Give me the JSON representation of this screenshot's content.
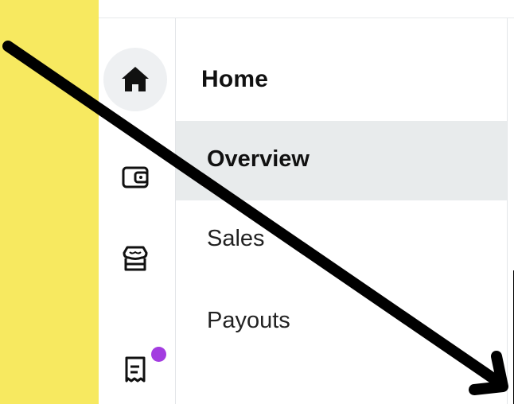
{
  "sidebar": {
    "icons": [
      {
        "name": "home-icon",
        "active": true
      },
      {
        "name": "wallet-icon",
        "active": false
      },
      {
        "name": "store-icon",
        "active": false
      },
      {
        "name": "receipt-icon",
        "active": false,
        "badge_color": "#a33ce0"
      }
    ]
  },
  "nav": {
    "title": "Home",
    "items": [
      {
        "label": "Overview",
        "active": true
      },
      {
        "label": "Sales",
        "active": false
      },
      {
        "label": "Payouts",
        "active": false
      }
    ]
  },
  "colors": {
    "highlight": "#f7e960",
    "active_background": "#e8ebec",
    "badge": "#a33ce0",
    "annotation_arrow": "#000000"
  }
}
